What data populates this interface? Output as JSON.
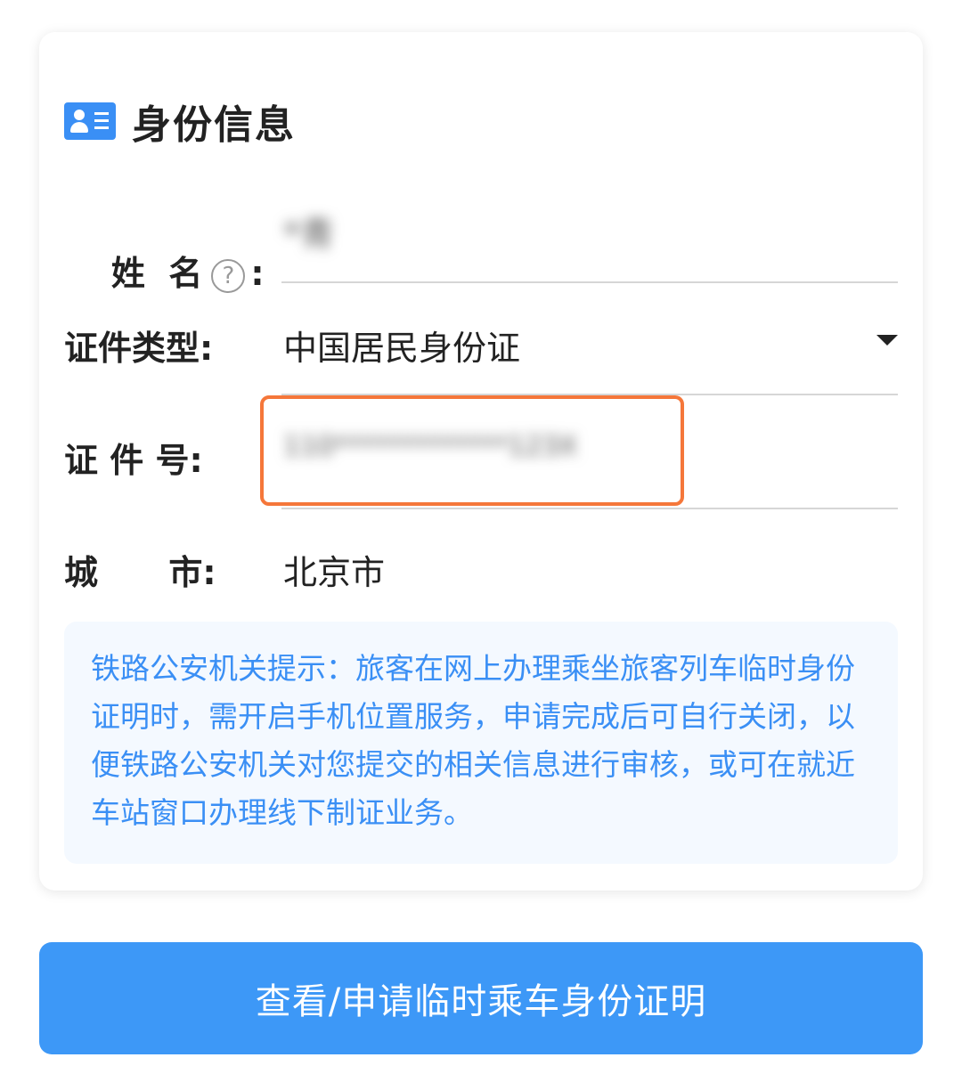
{
  "card": {
    "title": "身份信息",
    "title_icon": "id-card-icon"
  },
  "form": {
    "name": {
      "label": "姓  名",
      "help_icon": "question-circle-icon",
      "help_glyph": "?",
      "colon": ":",
      "value": "*青"
    },
    "id_type": {
      "label": "证件类型:",
      "value": "中国居民身份证",
      "arrow_icon": "caret-down-icon"
    },
    "id_number": {
      "label": "证 件 号:",
      "value": "110*************123X"
    },
    "city": {
      "label": "城      市:",
      "value": "北京市"
    }
  },
  "notice": {
    "text": "铁路公安机关提示：旅客在网上办理乘坐旅客列车临时身份证明时，需开启手机位置服务，申请完成后可自行关闭，以便铁路公安机关对您提交的相关信息进行审核，或可在就近车站窗口办理线下制证业务。"
  },
  "primary_button": {
    "label": "查看/申请临时乘车身份证明"
  },
  "colors": {
    "accent": "#3a8ff5",
    "button": "#3d98f7",
    "highlight": "#f5773a",
    "notice_bg": "#f4f9ff"
  }
}
